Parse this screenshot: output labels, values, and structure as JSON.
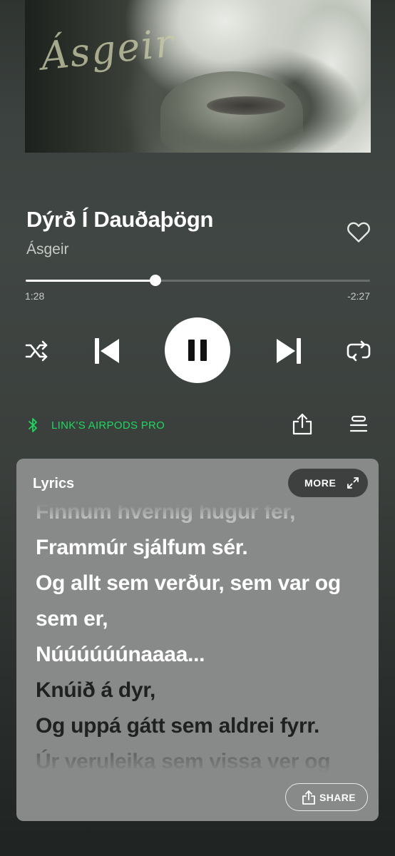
{
  "album_art": {
    "logo_text": "Ásgeir"
  },
  "track": {
    "title": "Dýrð Í Dauðaþögn",
    "artist": "Ásgeir",
    "liked": false
  },
  "playback": {
    "current_time": "1:28",
    "remaining_time": "-2:27",
    "progress": 0.3775,
    "state": "playing",
    "shuffle": false,
    "repeat": "off"
  },
  "device": {
    "name": "LINK'S AIRPODS PRO",
    "accent_color": "#1ed760",
    "icon": "bluetooth-icon"
  },
  "actions": {
    "share_icon": "share-icon",
    "queue_icon": "queue-icon"
  },
  "lyrics": {
    "title": "Lyrics",
    "more_label": "MORE",
    "share_label": "SHARE",
    "lines": [
      {
        "text": "Finnum hvernig hugur fer,",
        "state": "past-faded"
      },
      {
        "text": "Frammúr sjálfum sér.",
        "state": "past"
      },
      {
        "text": "Og allt sem verður, sem var og",
        "state": "past"
      },
      {
        "text": "sem er,",
        "state": "past"
      },
      {
        "text": "Núúúúúúnaaaa...",
        "state": "past"
      },
      {
        "text": "Knúið á dyr,",
        "state": "future"
      },
      {
        "text": "Og uppá gátt sem aldrei fyrr.",
        "state": "future"
      },
      {
        "text": "Úr veruleika sem vissa ver og",
        "state": "future-faded"
      }
    ],
    "background": "#878a88"
  }
}
